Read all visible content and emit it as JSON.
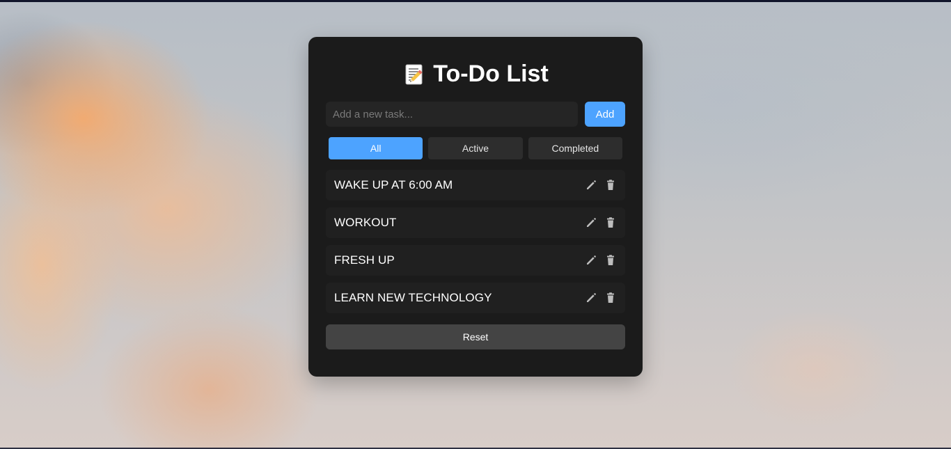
{
  "app": {
    "title": "To-Do List",
    "title_icon": "memo-icon"
  },
  "input": {
    "placeholder": "Add a new task...",
    "value": ""
  },
  "buttons": {
    "add": "Add",
    "reset": "Reset"
  },
  "filters": [
    {
      "label": "All",
      "active": true
    },
    {
      "label": "Active",
      "active": false
    },
    {
      "label": "Completed",
      "active": false
    }
  ],
  "tasks": [
    {
      "text": "WAKE UP AT 6:00 AM",
      "actions": [
        "pencil-icon",
        "trash-icon"
      ]
    },
    {
      "text": "WORKOUT",
      "actions": [
        "pencil-icon",
        "trash-icon"
      ]
    },
    {
      "text": "FRESH UP",
      "actions": [
        "pencil-icon",
        "trash-icon"
      ]
    },
    {
      "text": "LEARN NEW TECHNOLOGY",
      "actions": [
        "pencil-icon",
        "trash-icon"
      ]
    }
  ],
  "colors": {
    "accent": "#4da3ff",
    "card": "#1b1b1b",
    "task_background": "#202020",
    "button_dark": "#2d2d2d",
    "reset_button": "#444444",
    "text": "#ffffff",
    "icon": "#bdbdbd"
  }
}
